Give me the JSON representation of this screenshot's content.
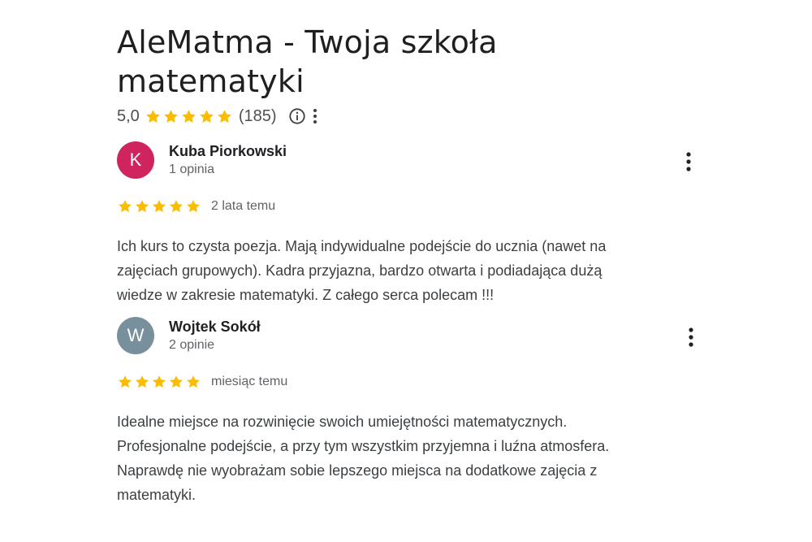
{
  "place": {
    "title": "AleMatma - Twoja szkoła matematyki",
    "rating_value": "5,0",
    "rating_count": "(185)",
    "star_color": "#fbbc04",
    "info_icon": "info-icon",
    "menu_icon": "more-vert-icon"
  },
  "reviews": [
    {
      "avatar_letter": "K",
      "avatar_color": "#d0245e",
      "author": "Kuba Piorkowski",
      "review_count": "1 opinia",
      "stars": 5,
      "date": "2 lata temu",
      "text_lines": [
        "Ich kurs to czysta poezja. Mają indywidualne podejście do ucznia (nawet na",
        "zajęciach grupowych). Kadra przyjazna, bardzo otwarta i podiadająca dużą",
        "wiedze w zakresie matematyki. Z całego serca polecam !!!"
      ]
    },
    {
      "avatar_letter": "W",
      "avatar_color": "#78909c",
      "author": "Wojtek Sokół",
      "review_count": "2 opinie",
      "stars": 5,
      "date": "miesiąc temu",
      "text_lines": [
        "Idealne miejsce na rozwinięcie swoich umiejętności matematycznych.",
        "Profesjonalne podejście, a przy tym wszystkim przyjemna i luźna atmosfera.",
        "Naprawdę nie wyobrażam sobie lepszego miejsca na dodatkowe zajęcia z",
        "matematyki."
      ]
    }
  ]
}
